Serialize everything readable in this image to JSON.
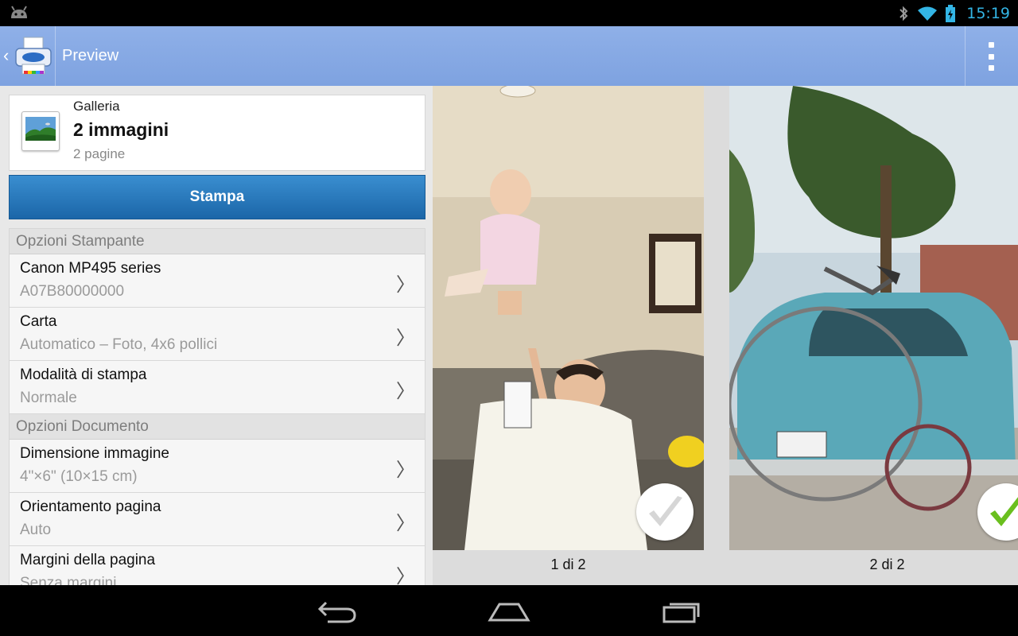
{
  "status": {
    "time": "15:19"
  },
  "actionbar": {
    "title": "Preview"
  },
  "gallery": {
    "source": "Galleria",
    "title": "2 immagini",
    "subtitle": "2 pagine"
  },
  "print_button": "Stampa",
  "printer_options": {
    "header": "Opzioni Stampante",
    "items": [
      {
        "title": "Canon MP495 series",
        "value": "A07B80000000"
      },
      {
        "title": "Carta",
        "value": "Automatico – Foto, 4x6 pollici"
      },
      {
        "title": "Modalità di stampa",
        "value": "Normale"
      }
    ]
  },
  "document_options": {
    "header": "Opzioni Documento",
    "items": [
      {
        "title": "Dimensione immagine",
        "value": "4\"×6\" (10×15 cm)"
      },
      {
        "title": "Orientamento pagina",
        "value": "Auto"
      },
      {
        "title": "Margini della pagina",
        "value": "Senza margini"
      }
    ]
  },
  "pages": [
    {
      "label": "1 di 2",
      "checked": false
    },
    {
      "label": "2 di 2",
      "checked": true
    }
  ],
  "colors": {
    "accent": "#33b5e5",
    "actionbar": "#8aaee8",
    "print_button": "#2a7cc0",
    "check_green": "#6abf1e"
  },
  "icons": {
    "up": "chevron-left-icon",
    "overflow": "overflow-menu-icon",
    "chevron": "chevron-right-icon"
  }
}
